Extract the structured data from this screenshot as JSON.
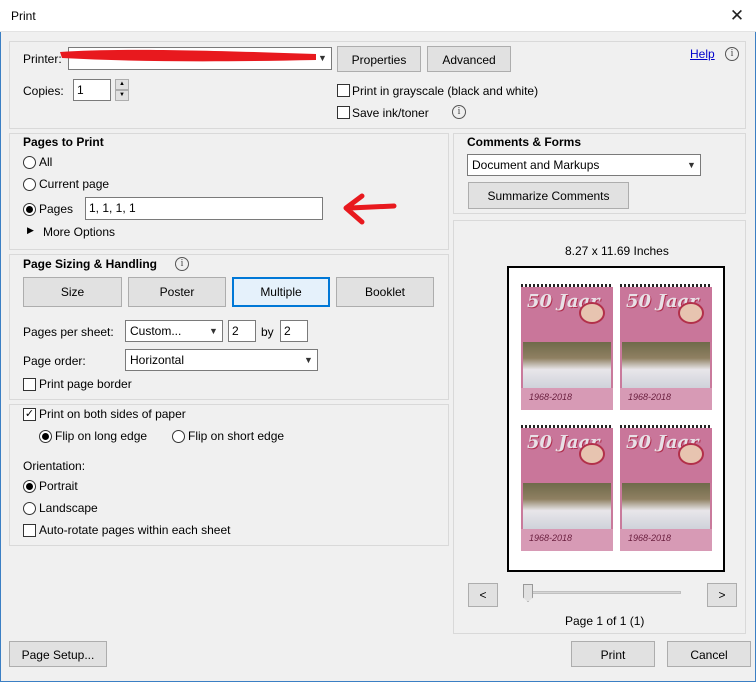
{
  "window": {
    "title": "Print"
  },
  "printer": {
    "label": "Printer:",
    "properties_btn": "Properties",
    "advanced_btn": "Advanced",
    "help_link": "Help"
  },
  "copies": {
    "label": "Copies:",
    "value": "1"
  },
  "options": {
    "grayscale": "Print in grayscale (black and white)",
    "save_ink": "Save ink/toner"
  },
  "pages_to_print": {
    "heading": "Pages to Print",
    "all": "All",
    "current": "Current page",
    "pages": "Pages",
    "pages_value": "1, 1, 1, 1",
    "more_options": "More Options"
  },
  "sizing": {
    "heading": "Page Sizing & Handling",
    "buttons": [
      "Size",
      "Poster",
      "Multiple",
      "Booklet"
    ],
    "pages_per_sheet_label": "Pages per sheet:",
    "pages_per_sheet_value": "Custom...",
    "cols": "2",
    "by": "by",
    "rows": "2",
    "page_order_label": "Page order:",
    "page_order_value": "Horizontal",
    "print_border": "Print page border"
  },
  "duplex": {
    "both_sides": "Print on both sides of paper",
    "long_edge": "Flip on long edge",
    "short_edge": "Flip on short edge"
  },
  "orientation": {
    "label": "Orientation:",
    "portrait": "Portrait",
    "landscape": "Landscape",
    "auto_rotate": "Auto-rotate pages within each sheet"
  },
  "comments": {
    "heading": "Comments & Forms",
    "value": "Document and Markups",
    "summarize": "Summarize Comments"
  },
  "preview": {
    "size_label": "8.27 x 11.69 Inches",
    "prev": "<",
    "next": ">",
    "page_status": "Page 1 of 1 (1)",
    "thumb_title": "50 Jaar",
    "thumb_years": "1968-2018"
  },
  "footer": {
    "page_setup": "Page Setup...",
    "print": "Print",
    "cancel": "Cancel"
  },
  "colors": {
    "accent": "#0078d7",
    "annotation_red": "#e8191e",
    "link": "#0000cc"
  }
}
